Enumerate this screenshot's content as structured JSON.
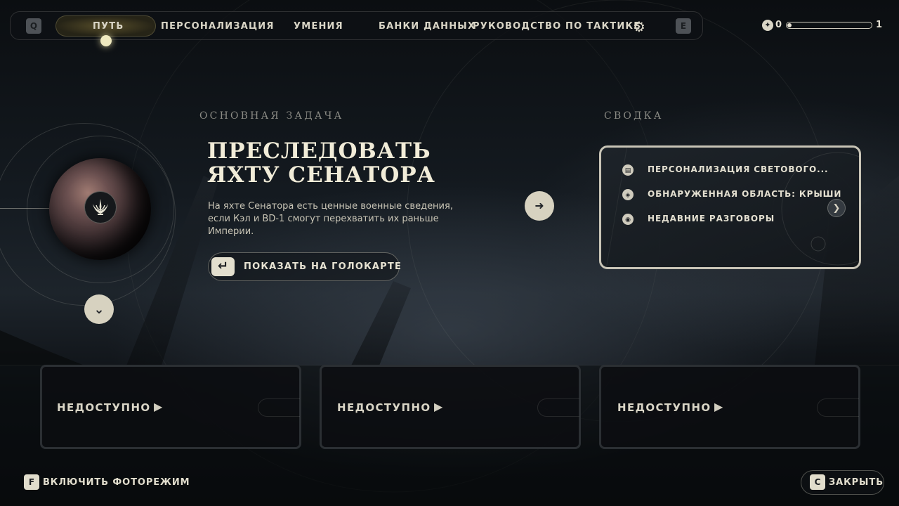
{
  "colors": {
    "accent": "#efe9bf",
    "text_primary": "#f1ecd8",
    "text_secondary": "#c9c5b6",
    "section_label": "#8a8a84",
    "card_border": "#c8c4b6",
    "button_fill": "#d7d2c0"
  },
  "topbar": {
    "left_key": "Q",
    "right_key": "E",
    "tabs": [
      {
        "label": "ПУТЬ",
        "active": true
      },
      {
        "label": "ПЕРСОНАЛИЗАЦИЯ",
        "active": false
      },
      {
        "label": "УМЕНИЯ",
        "active": false
      },
      {
        "label": "БАНКИ ДАННЫХ",
        "active": false
      },
      {
        "label": "РУКОВОДСТВО ПО ТАКТИКЕ",
        "active": false
      }
    ],
    "settings_icon": "gear-icon",
    "skill_points": {
      "icon": "skill-point-icon",
      "current": "0",
      "next": "1",
      "progress": 0.05
    }
  },
  "objective": {
    "section_label": "ОСНОВНАЯ ЗАДАЧА",
    "title_line1": "ПРЕСЛЕДОВАТЬ",
    "title_line2": "ЯХТУ СЕНАТОРА",
    "description": "На яхте Сенатора есть ценные военные сведения, если Кэл и BD-1 смогут перехватить их раньше Империи.",
    "holomap_key_icon": "enter-key-icon",
    "holomap_button": "ПОКАЗАТЬ НА ГОЛОКАРТЕ",
    "planet_emblem": "jedi-order-emblem-icon"
  },
  "summary": {
    "section_label": "СВОДКА",
    "items": [
      {
        "icon": "customization-icon",
        "text": "ПЕРСОНАЛИЗАЦИЯ СВЕТОВОГО..."
      },
      {
        "icon": "discovered-area-icon",
        "text": "ОБНАРУЖЕННАЯ ОБЛАСТЬ: КРЫШИ"
      },
      {
        "icon": "conversation-icon",
        "text": "НЕДАВНИЕ РАЗГОВОРЫ"
      }
    ]
  },
  "locked_cards": [
    {
      "label": "НЕДОСТУПНО"
    },
    {
      "label": "НЕДОСТУПНО"
    },
    {
      "label": "НЕДОСТУПНО"
    }
  ],
  "footer": {
    "photo_key": "F",
    "photo_label": "ВКЛЮЧИТЬ ФОТОРЕЖИМ",
    "close_key": "C",
    "close_label": "ЗАКРЫТЬ"
  }
}
